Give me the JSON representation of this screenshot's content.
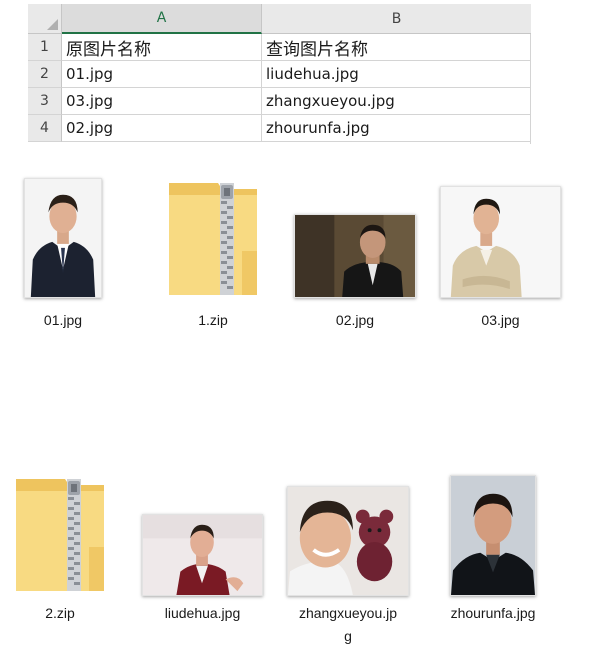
{
  "spreadsheet": {
    "columns": [
      "A",
      "B"
    ],
    "selected_column": "A",
    "rows": [
      {
        "num": "1",
        "a": "原图片名称",
        "b": "查询图片名称"
      },
      {
        "num": "2",
        "a": "01.jpg",
        "b": "liudehua.jpg"
      },
      {
        "num": "3",
        "a": "03.jpg",
        "b": "zhangxueyou.jpg"
      },
      {
        "num": "4",
        "a": "02.jpg",
        "b": "zhourunfa.jpg"
      }
    ]
  },
  "files_row1": [
    {
      "name": "01.jpg",
      "icon": "photo-thumbnail-icon"
    },
    {
      "name": "1.zip",
      "icon": "zip-folder-icon"
    },
    {
      "name": "02.jpg",
      "icon": "photo-thumbnail-icon"
    },
    {
      "name": "03.jpg",
      "icon": "photo-thumbnail-icon"
    }
  ],
  "files_row2": [
    {
      "name": "2.zip",
      "icon": "zip-folder-icon"
    },
    {
      "name": "liudehua.jpg",
      "icon": "photo-thumbnail-icon"
    },
    {
      "name_line1": "zhangxueyou.jp",
      "name_line2": "g",
      "icon": "photo-thumbnail-icon"
    },
    {
      "name": "zhourunfa.jpg",
      "icon": "photo-thumbnail-icon"
    }
  ],
  "colors": {
    "excel_green": "#217346",
    "folder_yellow": "#f7d774"
  }
}
